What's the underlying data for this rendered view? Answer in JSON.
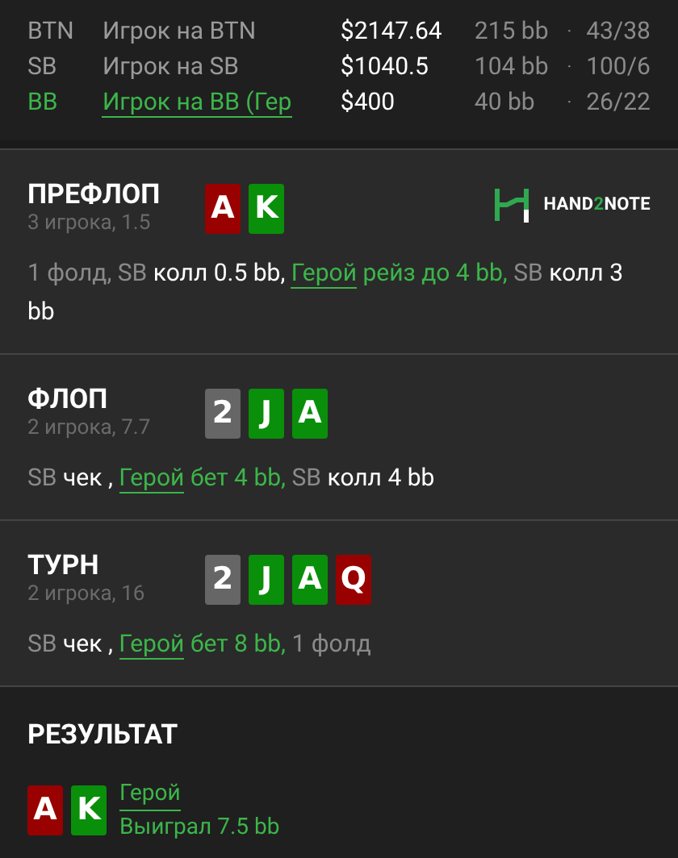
{
  "players": [
    {
      "position": "BTN",
      "name": "Игрок на BTN",
      "hero": false,
      "stack": "$2147.64",
      "bb": "215 bb",
      "separator": "·",
      "stats": "43/38"
    },
    {
      "position": "SB",
      "name": "Игрок на SB",
      "hero": false,
      "stack": "$1040.5",
      "bb": "104 bb",
      "separator": "·",
      "stats": "100/6"
    },
    {
      "position": "BB",
      "name": "Игрок на BB (Гер",
      "hero": true,
      "stack": "$400",
      "bb": "40 bb",
      "separator": "·",
      "stats": "26/22"
    }
  ],
  "streets": [
    {
      "title": "ПРЕФЛОП",
      "subtitle": "3 игрока, 1.5",
      "cards": [
        {
          "rank": "A",
          "color": "#990000"
        },
        {
          "rank": "K",
          "color": "#0a8f0a"
        }
      ],
      "logo": [
        "HAND",
        "2",
        "NOTE"
      ],
      "actions": [
        {
          "kind": "plain",
          "text": "1 фолд,"
        },
        {
          "kind": "player",
          "text": "SB"
        },
        {
          "kind": "action",
          "text": "колл 0.5 bb,"
        },
        {
          "kind": "hero",
          "text": "Герой"
        },
        {
          "kind": "hero_action",
          "text": "рейз до 4 bb,"
        },
        {
          "kind": "player",
          "text": "SB"
        },
        {
          "kind": "action",
          "text": "колл 3 bb"
        }
      ]
    },
    {
      "title": "ФЛОП",
      "subtitle": "2 игрока, 7.7",
      "cards": [
        {
          "rank": "2",
          "color": "#666666"
        },
        {
          "rank": "J",
          "color": "#0a8f0a"
        },
        {
          "rank": "A",
          "color": "#0a8f0a"
        }
      ],
      "actions": [
        {
          "kind": "player",
          "text": "SB"
        },
        {
          "kind": "action",
          "text": "чек ,"
        },
        {
          "kind": "hero",
          "text": "Герой"
        },
        {
          "kind": "hero_action",
          "text": "бет 4 bb,"
        },
        {
          "kind": "player",
          "text": "SB"
        },
        {
          "kind": "action",
          "text": "колл 4 bb"
        }
      ]
    },
    {
      "title": "ТУРН",
      "subtitle": "2 игрока, 16",
      "cards": [
        {
          "rank": "2",
          "color": "#666666"
        },
        {
          "rank": "J",
          "color": "#0a8f0a"
        },
        {
          "rank": "A",
          "color": "#0a8f0a"
        },
        {
          "rank": "Q",
          "color": "#990000"
        }
      ],
      "actions": [
        {
          "kind": "player",
          "text": "SB"
        },
        {
          "kind": "action",
          "text": "чек ,"
        },
        {
          "kind": "hero",
          "text": "Герой"
        },
        {
          "kind": "hero_action",
          "text": "бет 8 bb,"
        },
        {
          "kind": "plain",
          "text": "1 фолд"
        }
      ]
    }
  ],
  "result": {
    "title": "РЕЗУЛЬТАТ",
    "cards": [
      {
        "rank": "A",
        "color": "#990000"
      },
      {
        "rank": "K",
        "color": "#0a8f0a"
      }
    ],
    "player": "Герой",
    "outcome": "Выиграл 7.5 bb"
  }
}
